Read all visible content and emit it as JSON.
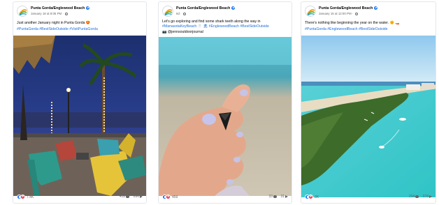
{
  "posts": [
    {
      "page_name": "Punta Gorda/Englewood Beach",
      "date": "January 18 at 8:05 PM",
      "text": "Just another January night in Punta Gorda 😍",
      "hashtags": "#PuntaGorda #BestSideOutside #VisitPuntaGorda",
      "reactions": "7.4K",
      "comments": "452",
      "shares": "696"
    },
    {
      "page_name": "Punta Gorda/Englewood Beach",
      "date": "6d",
      "text": "Let's go exploring and find some shark teeth along the way in",
      "hashtags": "#ManasotaKeyBeach 🦷 🏖 #EnglewoodBeach #BestSideOutside",
      "credit": "📷 @jennsoutdoorjournal",
      "reactions": "459",
      "comments": "33",
      "shares": "31"
    },
    {
      "page_name": "Punta Gorda/Englewood Beach",
      "date": "January 15 at 12:00 PM",
      "text": "There's nothing like beginning the year on the water. 🌞 🚤",
      "hashtags": "#PuntaGorda #EnglewoodBeach #BestSideOutside",
      "reactions": "3K",
      "comments": "204",
      "shares": "378"
    }
  ],
  "colors": {
    "link": "#216fdb",
    "like": "#1877f2",
    "love": "#f33e58",
    "meta": "#65676b"
  },
  "icons": [
    "brand-logo",
    "verified-badge",
    "globe-icon",
    "like-reaction-icon",
    "love-reaction-icon",
    "comment-icon",
    "share-icon"
  ]
}
